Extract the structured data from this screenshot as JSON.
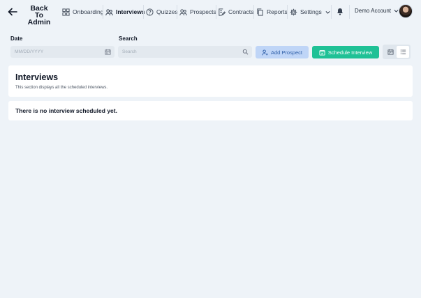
{
  "header": {
    "back_title": "Back To Admin",
    "nav": [
      {
        "label": "Onboarding",
        "icon": "grid-icon",
        "active": false
      },
      {
        "label": "Interviews",
        "icon": "users-icon",
        "active": true
      },
      {
        "label": "Quizzes",
        "icon": "question-circle-icon",
        "active": false
      },
      {
        "label": "Prospects",
        "icon": "users-icon",
        "active": false
      },
      {
        "label": "Contracts",
        "icon": "document-edit-icon",
        "active": false
      },
      {
        "label": "Reports",
        "icon": "copy-icon",
        "active": false
      },
      {
        "label": "Settings",
        "icon": "gear-icon",
        "active": false
      }
    ],
    "account_label": "Demo Account"
  },
  "filters": {
    "date_label": "Date",
    "date_placeholder": "MM/DD/YYYY",
    "search_label": "Search",
    "search_placeholder": "Search",
    "add_prospect_label": "Add Prospect",
    "schedule_interview_label": "Schedule Interview"
  },
  "interviews": {
    "title": "Interviews",
    "subtitle": "This section displays all the scheduled interviews.",
    "empty_message": "There is no interview scheduled yet."
  },
  "colors": {
    "accent_green": "#1fc196",
    "accent_blue_light": "#bfd5f7",
    "background": "#eef3f8"
  }
}
